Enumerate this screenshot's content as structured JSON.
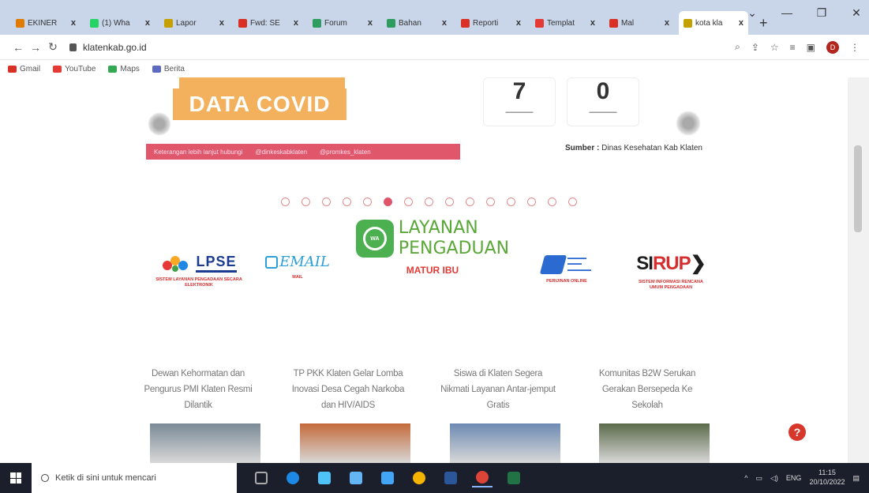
{
  "browser": {
    "tabs": [
      {
        "label": "EKINER",
        "color": "#e07b00"
      },
      {
        "label": "(1) Wha",
        "color": "#25d366"
      },
      {
        "label": "Lapor",
        "color": "#c4a000"
      },
      {
        "label": "Fwd: SE",
        "color": "#d93025"
      },
      {
        "label": "Forum",
        "color": "#2e9b5f"
      },
      {
        "label": "Bahan",
        "color": "#2e9b5f"
      },
      {
        "label": "Reporti",
        "color": "#d93025"
      },
      {
        "label": "Templat",
        "color": "#e53935"
      },
      {
        "label": "Mal",
        "color": "#d93025"
      },
      {
        "label": "kota kla",
        "color": "#c4a000"
      }
    ],
    "tab_close": "x",
    "new_tab": "+",
    "url": "klatenkab.go.id",
    "bookmarks": [
      {
        "label": "Gmail",
        "color": "#d93025"
      },
      {
        "label": "YouTube",
        "color": "#e53935"
      },
      {
        "label": "Maps",
        "color": "#34a853"
      },
      {
        "label": "Berita",
        "color": "#5c6bc0"
      }
    ],
    "profile_initial": "D"
  },
  "covid": {
    "title": "DATA COVID",
    "strip_texts": [
      "Keterangan lebih lanjut hubungi",
      "@dinkeskabklaten",
      "@promkes_klaten"
    ],
    "stat_1": "7",
    "stat_2": "0",
    "source_label": "Sumber :",
    "source_text": "Dinas Kesehatan Kab Klaten"
  },
  "carousel": {
    "dot_count": 15,
    "active_index": 5
  },
  "services": {
    "lpse": {
      "name": "LPSE",
      "caption": "SISTEM LAYANAN PENGADAAN SECARA ELEKTRONIK"
    },
    "email": {
      "name": "EMAIL",
      "caption": "MAIL"
    },
    "layanan": {
      "line1": "LAYANAN",
      "line2": "PENGADUAN",
      "subtitle": "MATUR IBU",
      "icon_text": "WA"
    },
    "perijinan": {
      "caption": "PERIJINAN ONLINE"
    },
    "sirup": {
      "name_dark": "SI",
      "name_red": "RUP",
      "caption": "SISTEM INFORMASI RENCANA UMUM PENGADAAN"
    }
  },
  "news": [
    {
      "title": "Dewan Kehormatan dan Pengurus PMI Klaten Resmi Dilantik",
      "img": "#7a8a96"
    },
    {
      "title": "TP PKK Klaten Gelar Lomba Inovasi Desa Cegah Narkoba dan HIV/AIDS",
      "img": "#c46a3a"
    },
    {
      "title": "Siswa di Klaten Segera Nikmati Layanan Antar-jemput Gratis",
      "img": "#6d8ab3"
    },
    {
      "title": "Komunitas B2W Serukan Gerakan Bersepeda Ke Sekolah",
      "img": "#5b6b4a"
    }
  ],
  "help_label": "?",
  "taskbar": {
    "search_placeholder": "Ketik di sini untuk mencari",
    "language": "ENG",
    "time": "11:15",
    "date": "20/10/2022"
  }
}
